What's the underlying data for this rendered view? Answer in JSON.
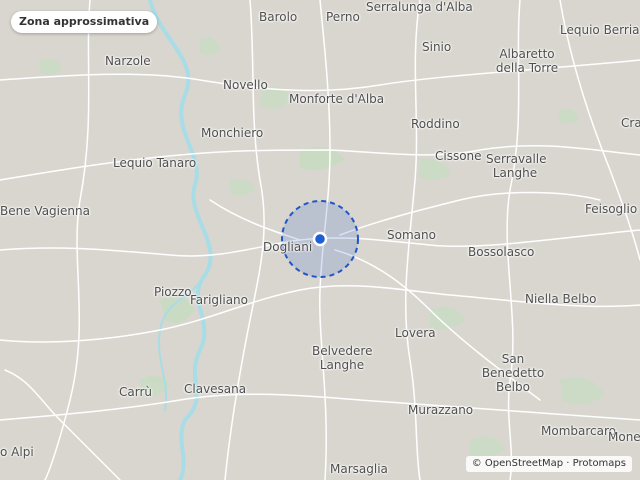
{
  "map": {
    "area_badge": "Zona approssimativa",
    "attribution": {
      "osm": "OpenStreetMap",
      "separator": "·",
      "tiles": "Protomaps"
    },
    "colors": {
      "land": "#d9d6cf",
      "vegetation": "#c8dcc3",
      "river": "#a8dce6",
      "road": "#ffffff",
      "accuracy_fill": "#3f6fd1",
      "marker": "#1f5fd6"
    },
    "places": [
      {
        "name": "Barolo"
      },
      {
        "name": "Perno"
      },
      {
        "name": "Serralunga d'Alba"
      },
      {
        "name": "Sinio"
      },
      {
        "name": "Albaretto della Torre"
      },
      {
        "name": "Lequio Berria"
      },
      {
        "name": "Narzole"
      },
      {
        "name": "Novello"
      },
      {
        "name": "Monforte d'Alba"
      },
      {
        "name": "Monchiero"
      },
      {
        "name": "Roddino"
      },
      {
        "name": "Cra"
      },
      {
        "name": "Lequio Tanaro"
      },
      {
        "name": "Cissone"
      },
      {
        "name": "Serravalle Langhe"
      },
      {
        "name": "Bene Vagienna"
      },
      {
        "name": "Feisoglio"
      },
      {
        "name": "Dogliani"
      },
      {
        "name": "Somano"
      },
      {
        "name": "Bossolasco"
      },
      {
        "name": "Piozzo"
      },
      {
        "name": "Farigliano"
      },
      {
        "name": "Niella Belbo"
      },
      {
        "name": "Lovera"
      },
      {
        "name": "Belvedere Langhe"
      },
      {
        "name": "San Benedetto Belbo"
      },
      {
        "name": "Carrù"
      },
      {
        "name": "Clavesana"
      },
      {
        "name": "Murazzano"
      },
      {
        "name": "Mombarcaro"
      },
      {
        "name": "Mone"
      },
      {
        "name": "o Alpi"
      },
      {
        "name": "Marsaglia"
      }
    ]
  }
}
